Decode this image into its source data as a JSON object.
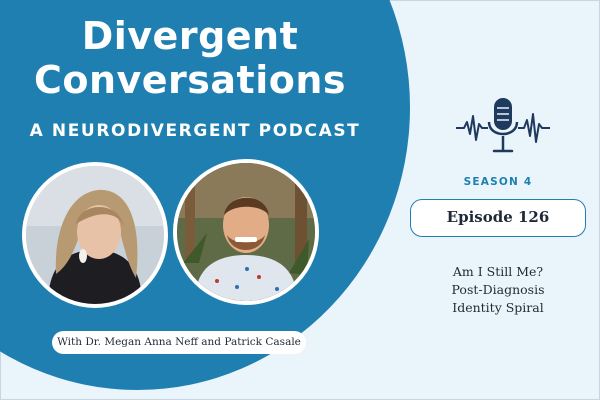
{
  "podcast": {
    "title_line1": "Divergent",
    "title_line2": "Conversations",
    "tagline": "A NEURODIVERGENT PODCAST",
    "hosts": "With Dr. Megan Anna Neff and Patrick Casale"
  },
  "episode": {
    "season": "SEASON 4",
    "number": "Episode 126",
    "title_lines": [
      "Am I Still Me?",
      "Post-Diagnosis",
      "Identity Spiral"
    ]
  },
  "colors": {
    "primary": "#1e7fb0",
    "dark_navy": "#1f3a5f",
    "background": "#eaf4fb"
  },
  "icons": {
    "podcast_icon": "microphone-icon"
  }
}
